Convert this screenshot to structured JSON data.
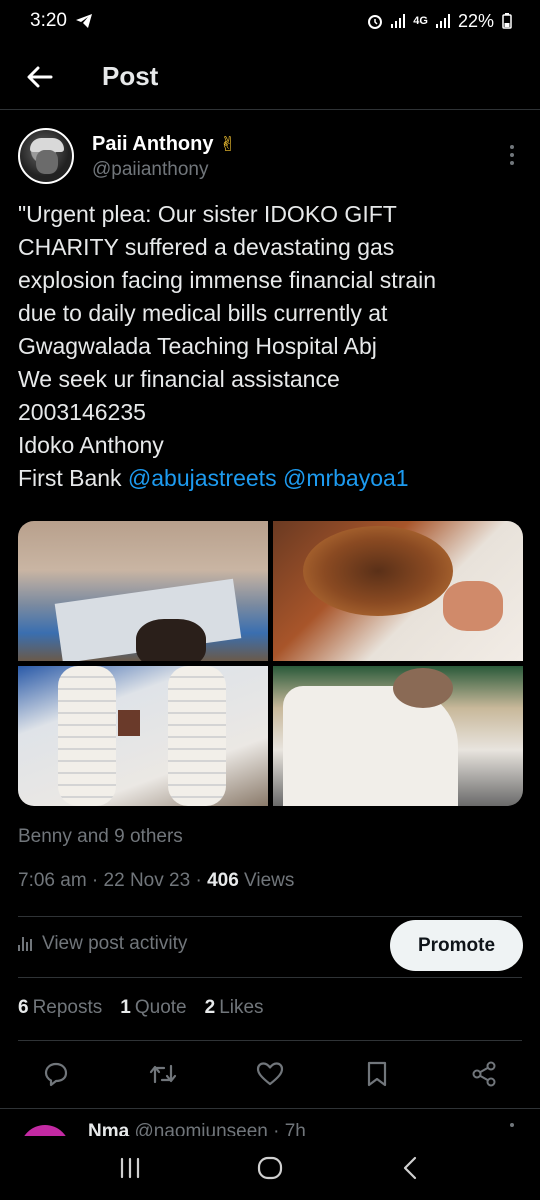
{
  "status_bar": {
    "time": "3:20",
    "network": "4G",
    "battery": "22%"
  },
  "header": {
    "title": "Post"
  },
  "author": {
    "display_name": "Paii Anthony",
    "badge_emoji": "✌",
    "handle": "@paiianthony"
  },
  "post": {
    "lines": [
      "\"Urgent plea: Our sister IDOKO GIFT",
      "CHARITY suffered a devastating gas",
      "explosion facing immense financial strain",
      "due to daily medical bills currently at",
      "Gwagwalada Teaching Hospital Abj",
      "We seek ur financial assistance",
      "2003146235",
      "Idoko Anthony"
    ],
    "last_line_prefix": "First Bank",
    "mentions": [
      "@abujastreets",
      "@mrbayoa1"
    ]
  },
  "engagement": {
    "liked_by": "Benny and 9 others",
    "time": "7:06 am",
    "date": "22 Nov 23",
    "views_count": "406",
    "views_label": "Views",
    "activity_label": "View post activity",
    "promote_label": "Promote",
    "reposts_count": "6",
    "reposts_label": "Reposts",
    "quotes_count": "1",
    "quotes_label": "Quote",
    "likes_count": "2",
    "likes_label": "Likes"
  },
  "reply_preview": {
    "name": "Nma",
    "handle_time": "@naomiunseen · 7h"
  },
  "icons": {
    "back": "arrow-left-icon",
    "more": "more-vertical-icon",
    "reply": "reply-icon",
    "repost": "repost-icon",
    "like": "heart-icon",
    "bookmark": "bookmark-icon",
    "share": "share-icon"
  },
  "colors": {
    "background": "#000000",
    "link": "#1d9bf0",
    "muted": "#71767b",
    "text": "#e7e9ea",
    "promote_bg": "#eff3f4"
  }
}
